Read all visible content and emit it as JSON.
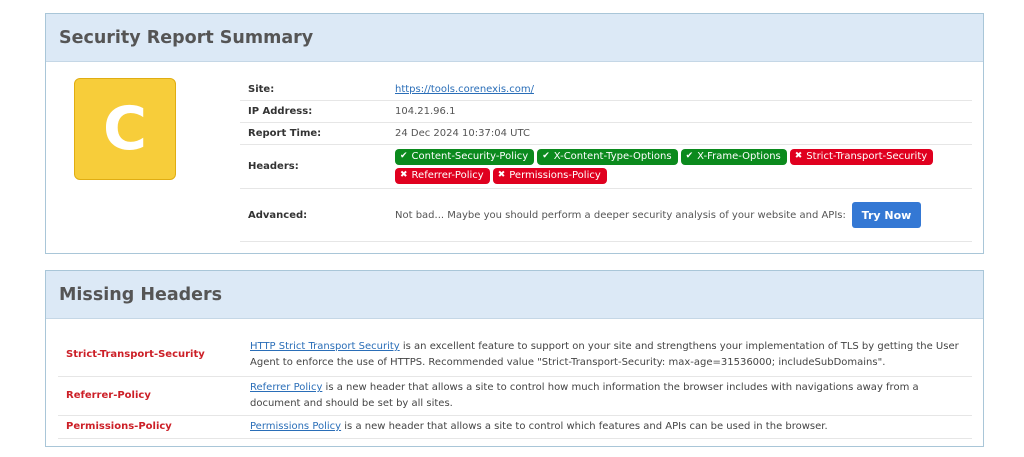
{
  "summary": {
    "title": "Security Report Summary",
    "grade": "C",
    "grade_color": "#f7cd3a",
    "site_label": "Site:",
    "site_value": "https://tools.corenexis.com/",
    "ip_label": "IP Address:",
    "ip_value": "104.21.96.1",
    "time_label": "Report Time:",
    "time_value": "24 Dec 2024 10:37:04 UTC",
    "headers_label": "Headers:",
    "headers": [
      {
        "label": "Content-Security-Policy",
        "status": "present",
        "icon": "check-icon"
      },
      {
        "label": "X-Content-Type-Options",
        "status": "present",
        "icon": "check-icon"
      },
      {
        "label": "X-Frame-Options",
        "status": "present",
        "icon": "check-icon"
      },
      {
        "label": "Strict-Transport-Security",
        "status": "missing",
        "icon": "x-icon"
      },
      {
        "label": "Referrer-Policy",
        "status": "missing",
        "icon": "x-icon"
      },
      {
        "label": "Permissions-Policy",
        "status": "missing",
        "icon": "x-icon"
      }
    ],
    "advanced_label": "Advanced:",
    "advanced_text": "Not bad... Maybe you should perform a deeper security analysis of your website and APIs:",
    "try_now_label": "Try Now"
  },
  "missing": {
    "title": "Missing Headers",
    "rows": [
      {
        "name": "Strict-Transport-Security",
        "link": "HTTP Strict Transport Security",
        "text": " is an excellent feature to support on your site and strengthens your implementation of TLS by getting the User Agent to enforce the use of HTTPS. Recommended value \"Strict-Transport-Security: max-age=31536000; includeSubDomains\"."
      },
      {
        "name": "Referrer-Policy",
        "link": "Referrer Policy",
        "text": " is a new header that allows a site to control how much information the browser includes with navigations away from a document and should be set by all sites."
      },
      {
        "name": "Permissions-Policy",
        "link": "Permissions Policy",
        "text": " is a new header that allows a site to control which features and APIs can be used in the browser."
      }
    ]
  },
  "colors": {
    "present": "#0b8a1d",
    "missing": "#e0001f",
    "header_bg": "#dce9f6",
    "button": "#3478d4"
  }
}
